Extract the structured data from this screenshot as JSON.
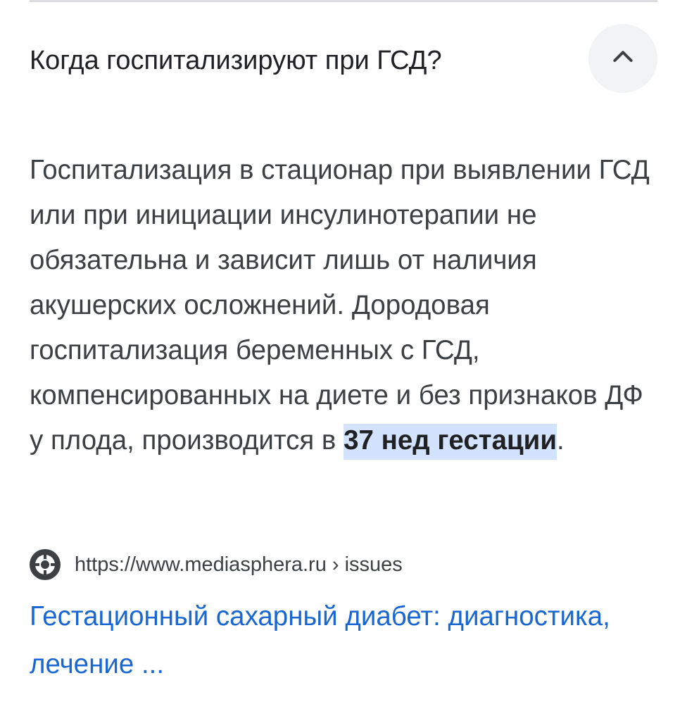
{
  "question": {
    "text": "Когда госпитализируют при ГСД?",
    "collapse_icon": "chevron-up-icon"
  },
  "answer": {
    "text_before": "Госпитализация в стационар при выявлении ГСД или при инициации инсулинотерапии не обязательна и зависит лишь от наличия акушерских осложнений. Дородовая госпитализация беременных с ГСД, компенсированных на диете и без признаков ДФ у плода, производится в ",
    "highlight": "37 нед гестации",
    "text_after": "."
  },
  "source": {
    "favicon": "site-favicon-icon",
    "url": "https://www.mediasphera.ru › issues"
  },
  "result": {
    "title": "Гестационный сахарный диабет: диагностика, лечение ..."
  },
  "colors": {
    "link": "#1967d2",
    "highlight_bg": "#d3e3fd",
    "button_bg": "#f1f3f4",
    "divider": "#dadce0"
  }
}
